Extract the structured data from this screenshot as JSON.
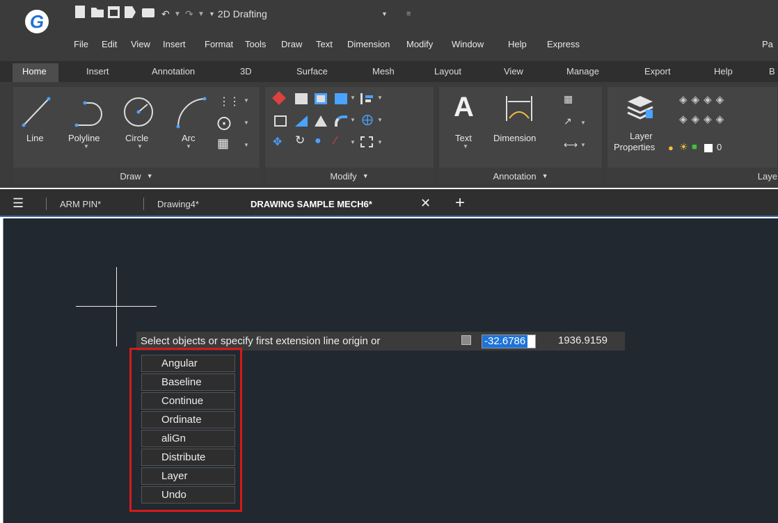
{
  "app": {
    "logo_letter": "G",
    "workspace": "2D Drafting"
  },
  "quick_access": [
    "new-icon",
    "open-icon",
    "save-icon",
    "saveas-icon",
    "print-icon",
    "undo-icon",
    "redo-icon"
  ],
  "menubar": [
    "File",
    "Edit",
    "View",
    "Insert",
    "Format",
    "Tools",
    "Draw",
    "Text",
    "Dimension",
    "Modify",
    "Window",
    "Help",
    "Express",
    "Pa"
  ],
  "ribbon_tabs": [
    "Home",
    "Insert",
    "Annotation",
    "3D",
    "Surface",
    "Mesh",
    "Layout",
    "View",
    "Manage",
    "Export",
    "Help",
    "B"
  ],
  "draw_panel": {
    "title": "Draw",
    "tools": [
      "Line",
      "Polyline",
      "Circle",
      "Arc"
    ]
  },
  "modify_panel": {
    "title": "Modify"
  },
  "annotation_panel": {
    "title": "Annotation",
    "tools": [
      "Text",
      "Dimension"
    ]
  },
  "layer_panel": {
    "title": "Laye",
    "tool_line1": "Layer",
    "tool_line2": "Properties",
    "layer_value": "0"
  },
  "doc_tabs": [
    "ARM PIN*",
    "Drawing4*",
    "DRAWING SAMPLE MECH6*"
  ],
  "prompt": {
    "text": "Select objects or specify first extension line origin or",
    "x_value": "-32.6786",
    "y_value": "1936.9159"
  },
  "options": [
    "Angular",
    "Baseline",
    "Continue",
    "Ordinate",
    "aliGn",
    "Distribute",
    "Layer",
    "Undo"
  ],
  "colors": {
    "accent": "#1e73d8",
    "highlight_border": "#d61a1a",
    "canvas": "#212830"
  }
}
